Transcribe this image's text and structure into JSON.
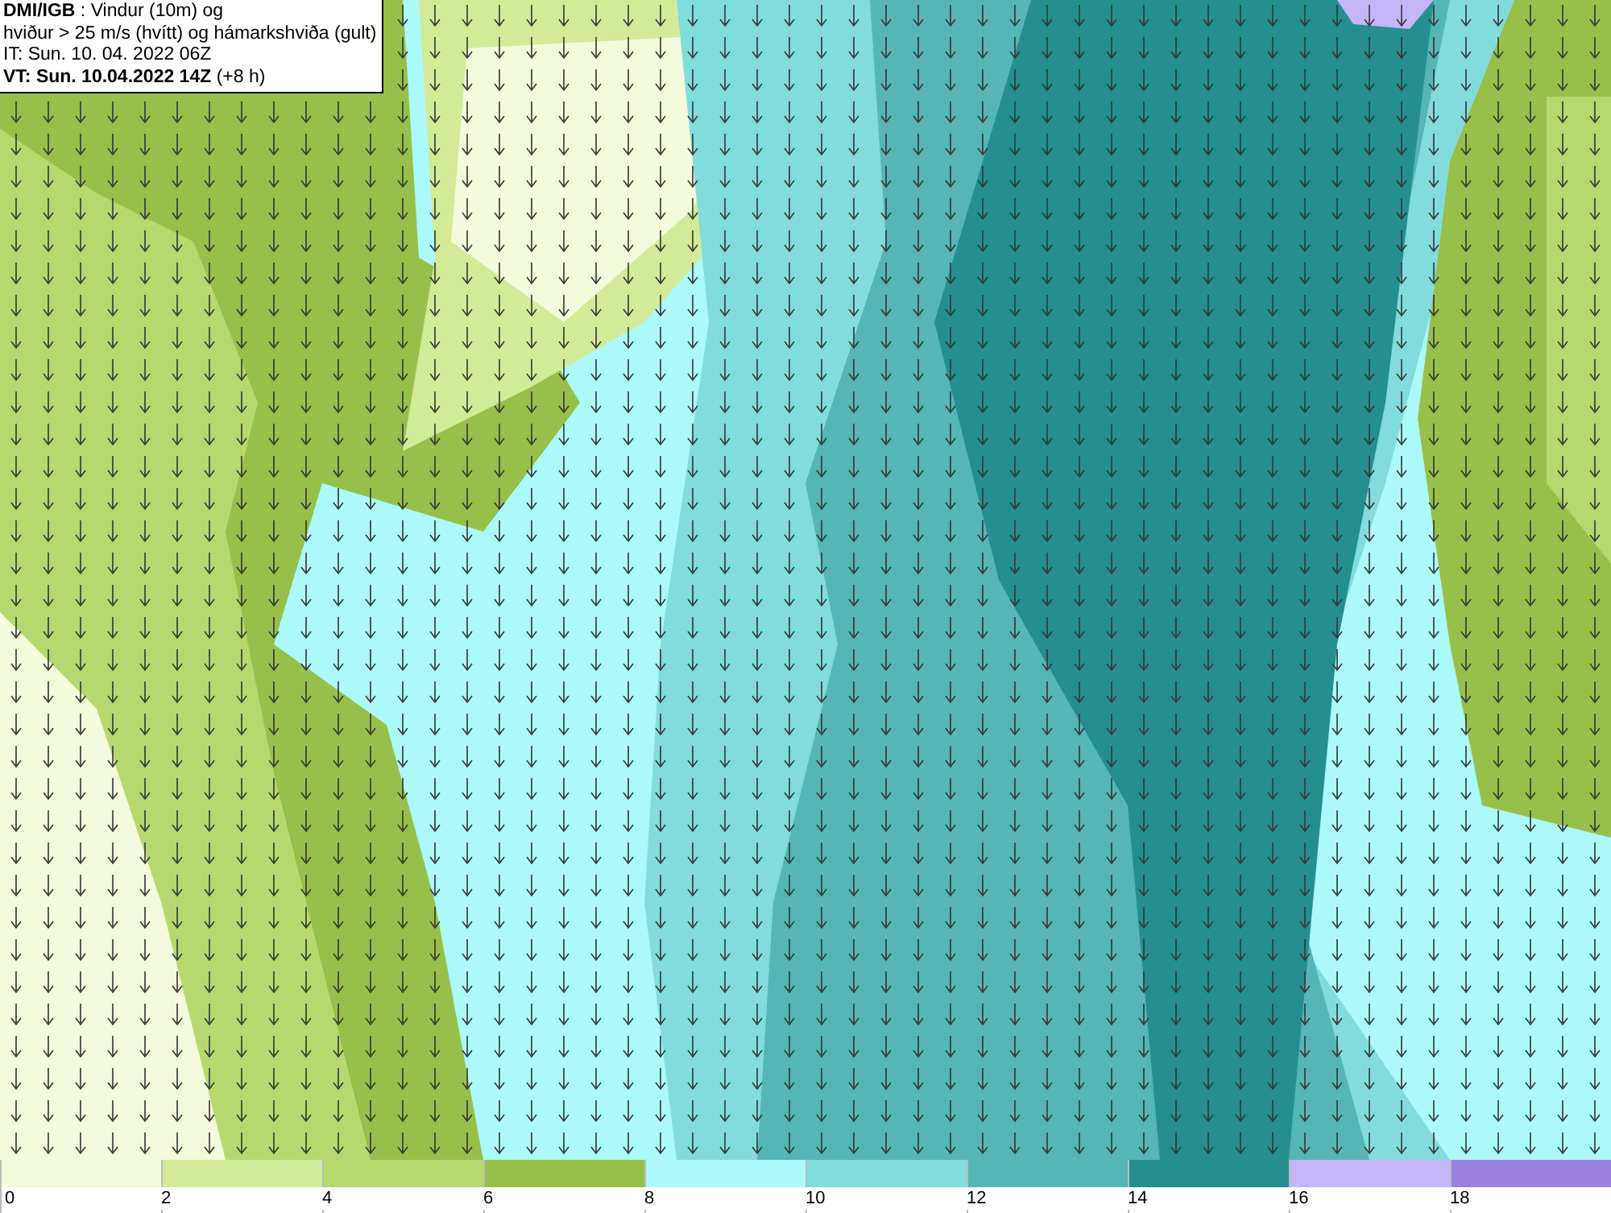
{
  "info_box": {
    "lines": [
      "**DMI/IGB** : Vindur (10m) og",
      "hviður > 25 m/s (hvítt) og hámarkshviða (gult)",
      "IT: Sun. 10. 04. 2022 06Z",
      "**VT: Sun. 10.04.2022 14Z** (+8 h)"
    ]
  },
  "legend": [
    {
      "label": "0",
      "color": "#f3fbdc"
    },
    {
      "label": "2",
      "color": "#d3eb98"
    },
    {
      "label": "4",
      "color": "#b5d96e"
    },
    {
      "label": "6",
      "color": "#97c04a"
    },
    {
      "label": "8",
      "color": "#acf9fa"
    },
    {
      "label": "10",
      "color": "#82dcdc"
    },
    {
      "label": "12",
      "color": "#56b5b5"
    },
    {
      "label": "14",
      "color": "#258f8f"
    },
    {
      "label": "16",
      "color": "#c4b6f9"
    },
    {
      "label": "18",
      "color": "#9c82e0"
    }
  ]
}
